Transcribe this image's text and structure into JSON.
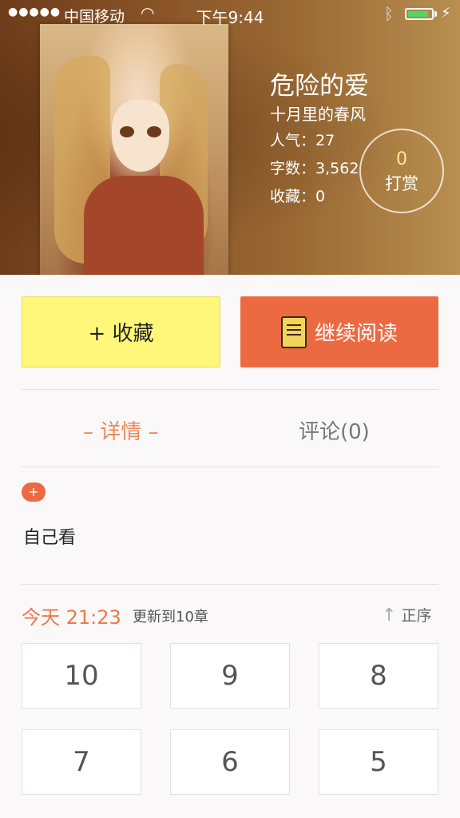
{
  "status_bar": {
    "signal": "●●●●●",
    "carrier": "中国移动",
    "time": "下午9:44",
    "battery_level": 0.9
  },
  "book": {
    "title": "危险的爱",
    "author": "十月里的春风",
    "stats": [
      {
        "label": "人气：",
        "value": "27"
      },
      {
        "label": "字数：",
        "value": "3,562"
      },
      {
        "label": "收藏：",
        "value": "0"
      }
    ],
    "tip": {
      "count": "0",
      "label": "打赏"
    }
  },
  "actions": {
    "favorite_label": "+ 收藏",
    "continue_label": "继续阅读"
  },
  "tabs": {
    "detail": "– 详情 –",
    "comments": "评论(0)"
  },
  "detail": {
    "badge": "+",
    "description": "自己看"
  },
  "chapters": {
    "update_time": "今天 21:23",
    "update_text": "更新到10章",
    "order_arrow": "↑",
    "order_label": "正序",
    "items": [
      "10",
      "9",
      "8",
      "7",
      "6",
      "5"
    ]
  },
  "colors": {
    "accent": "#ec6a42",
    "favorite_bg": "#fff77a",
    "tab_active": "#ec8a5a"
  }
}
